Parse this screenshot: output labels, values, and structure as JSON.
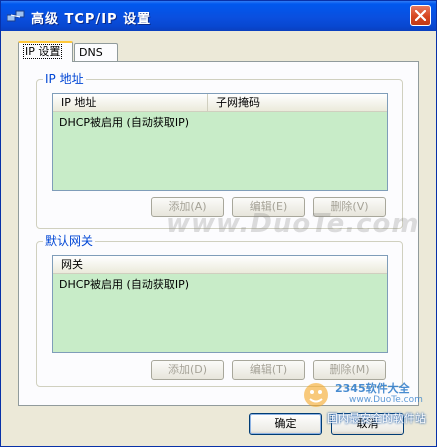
{
  "window": {
    "title": "高级 TCP/IP 设置",
    "close_label": "×"
  },
  "tabs": [
    {
      "label": "IP 设置",
      "active": true
    },
    {
      "label": "DNS",
      "active": false
    }
  ],
  "ip_group": {
    "label": "IP 地址",
    "columns": [
      "IP 地址",
      "子网掩码"
    ],
    "rows": [
      "DHCP被启用 (自动获取IP)"
    ],
    "buttons": {
      "add": "添加(A)",
      "edit": "编辑(E)",
      "delete": "删除(V)"
    }
  },
  "gateway_group": {
    "label": "默认网关",
    "columns": [
      "网关"
    ],
    "rows": [
      "DHCP被启用 (自动获取IP)"
    ],
    "buttons": {
      "add": "添加(D)",
      "edit": "编辑(T)",
      "delete": "删除(M)"
    }
  },
  "footer": {
    "ok": "确定",
    "cancel": "取消"
  },
  "watermark": "www.DuoTe.com",
  "logo": {
    "brand": "2345软件大全",
    "url": "www.DuoTe.com",
    "slogan": "国内最安全的软件站"
  },
  "colors": {
    "title_bar": "#0a4fdf",
    "list_bg": "#c8ecc8",
    "group_label": "#0046d5",
    "window_bg": "#ece9d8"
  }
}
